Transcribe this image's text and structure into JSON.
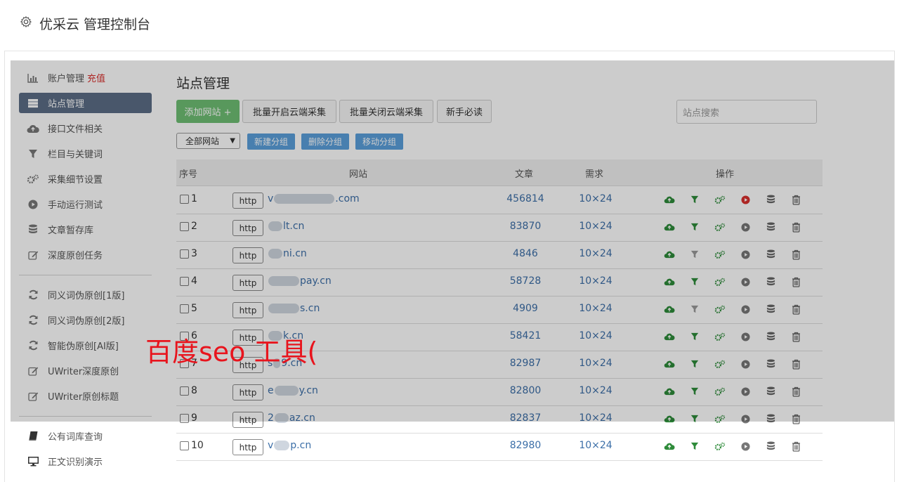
{
  "header": {
    "title": "优采云 管理控制台"
  },
  "sidebar": {
    "items": [
      {
        "label": "账户管理",
        "extra": "充值",
        "icon": "bar-chart-icon"
      },
      {
        "label": "站点管理",
        "icon": "server-icon"
      },
      {
        "label": "接口文件相关",
        "icon": "cloud-upload-icon"
      },
      {
        "label": "栏目与关键词",
        "icon": "filter-icon"
      },
      {
        "label": "采集细节设置",
        "icon": "cogs-icon"
      },
      {
        "label": "手动运行测试",
        "icon": "play-icon"
      },
      {
        "label": "文章暂存库",
        "icon": "database-icon"
      },
      {
        "label": "深度原创任务",
        "icon": "edit-icon"
      },
      {
        "label": "同义词伪原创[1版]",
        "icon": "refresh-icon"
      },
      {
        "label": "同义词伪原创[2版]",
        "icon": "refresh-icon"
      },
      {
        "label": "智能伪原创[AI版]",
        "icon": "refresh-icon"
      },
      {
        "label": "UWriter深度原创",
        "icon": "edit-icon"
      },
      {
        "label": "UWriter原创标题",
        "icon": "edit-icon"
      },
      {
        "label": "公有词库查询",
        "icon": "book-icon"
      },
      {
        "label": "正文识别演示",
        "icon": "monitor-icon"
      }
    ]
  },
  "main": {
    "title": "站点管理",
    "buttons": {
      "add": "添加网站 +",
      "batch_open": "批量开启云端采集",
      "batch_close": "批量关闭云端采集",
      "guide": "新手必读"
    },
    "search_placeholder": "站点搜索",
    "group_select": "全部网站",
    "group_buttons": {
      "new": "新建分组",
      "delete": "删除分组",
      "move": "移动分组"
    },
    "table": {
      "headers": {
        "index": "序号",
        "site": "网站",
        "articles": "文章",
        "demand": "需求",
        "actions": "操作"
      },
      "rows": [
        {
          "num": "1",
          "prefix": "http",
          "site_a": "v",
          "site_b": ".com",
          "articles": "456814",
          "demand": "10×24"
        },
        {
          "num": "2",
          "prefix": "http",
          "site_a": "",
          "site_b": "lt.cn",
          "articles": "83870",
          "demand": "10×24"
        },
        {
          "num": "3",
          "prefix": "http",
          "site_a": "",
          "site_b": "ni.cn",
          "articles": "4846",
          "demand": "10×24"
        },
        {
          "num": "4",
          "prefix": "http",
          "site_a": "",
          "site_b": "pay.cn",
          "articles": "58728",
          "demand": "10×24"
        },
        {
          "num": "5",
          "prefix": "http",
          "site_a": "",
          "site_b": "s.cn",
          "articles": "4909",
          "demand": "10×24"
        },
        {
          "num": "6",
          "prefix": "http",
          "site_a": "",
          "site_b": "k.cn",
          "articles": "58421",
          "demand": "10×24"
        },
        {
          "num": "7",
          "prefix": "http",
          "site_a": "s",
          "site_b": "9.cn",
          "articles": "82987",
          "demand": "10×24"
        },
        {
          "num": "8",
          "prefix": "http",
          "site_a": "e",
          "site_b": "y.cn",
          "articles": "82800",
          "demand": "10×24"
        },
        {
          "num": "9",
          "prefix": "http",
          "site_a": "2",
          "site_b": "az.cn",
          "articles": "82837",
          "demand": "10×24"
        },
        {
          "num": "10",
          "prefix": "http",
          "site_a": "v",
          "site_b": "p.cn",
          "articles": "82980",
          "demand": "10×24"
        }
      ]
    }
  },
  "watermark": "百度seo 工具(",
  "colors": {
    "active_nav": "#5c6d86",
    "link": "#3c6fa8",
    "green": "#6fbf73",
    "red": "#d9302e",
    "blue_btn": "#5a9fdb"
  }
}
